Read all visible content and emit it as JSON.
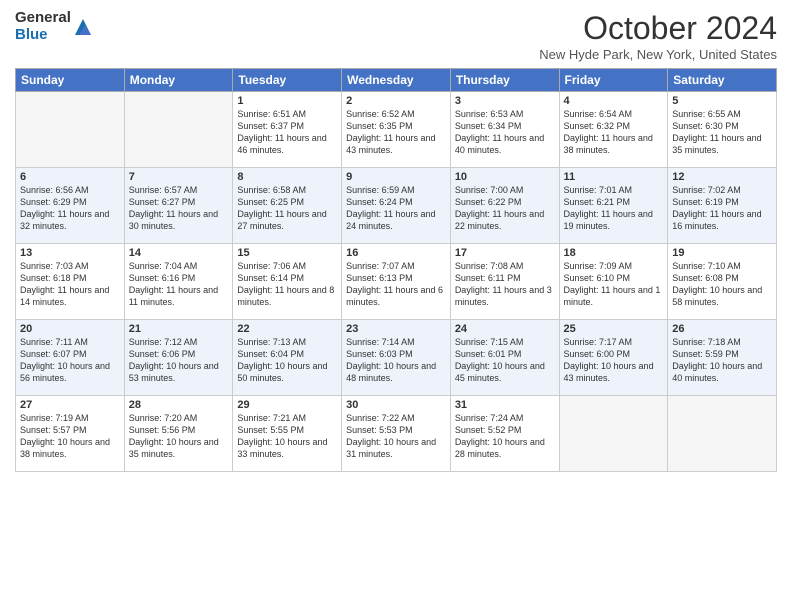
{
  "logo": {
    "general": "General",
    "blue": "Blue"
  },
  "title": "October 2024",
  "location": "New Hyde Park, New York, United States",
  "days_of_week": [
    "Sunday",
    "Monday",
    "Tuesday",
    "Wednesday",
    "Thursday",
    "Friday",
    "Saturday"
  ],
  "weeks": [
    [
      {
        "day": "",
        "info": ""
      },
      {
        "day": "",
        "info": ""
      },
      {
        "day": "1",
        "info": "Sunrise: 6:51 AM\nSunset: 6:37 PM\nDaylight: 11 hours and 46 minutes."
      },
      {
        "day": "2",
        "info": "Sunrise: 6:52 AM\nSunset: 6:35 PM\nDaylight: 11 hours and 43 minutes."
      },
      {
        "day": "3",
        "info": "Sunrise: 6:53 AM\nSunset: 6:34 PM\nDaylight: 11 hours and 40 minutes."
      },
      {
        "day": "4",
        "info": "Sunrise: 6:54 AM\nSunset: 6:32 PM\nDaylight: 11 hours and 38 minutes."
      },
      {
        "day": "5",
        "info": "Sunrise: 6:55 AM\nSunset: 6:30 PM\nDaylight: 11 hours and 35 minutes."
      }
    ],
    [
      {
        "day": "6",
        "info": "Sunrise: 6:56 AM\nSunset: 6:29 PM\nDaylight: 11 hours and 32 minutes."
      },
      {
        "day": "7",
        "info": "Sunrise: 6:57 AM\nSunset: 6:27 PM\nDaylight: 11 hours and 30 minutes."
      },
      {
        "day": "8",
        "info": "Sunrise: 6:58 AM\nSunset: 6:25 PM\nDaylight: 11 hours and 27 minutes."
      },
      {
        "day": "9",
        "info": "Sunrise: 6:59 AM\nSunset: 6:24 PM\nDaylight: 11 hours and 24 minutes."
      },
      {
        "day": "10",
        "info": "Sunrise: 7:00 AM\nSunset: 6:22 PM\nDaylight: 11 hours and 22 minutes."
      },
      {
        "day": "11",
        "info": "Sunrise: 7:01 AM\nSunset: 6:21 PM\nDaylight: 11 hours and 19 minutes."
      },
      {
        "day": "12",
        "info": "Sunrise: 7:02 AM\nSunset: 6:19 PM\nDaylight: 11 hours and 16 minutes."
      }
    ],
    [
      {
        "day": "13",
        "info": "Sunrise: 7:03 AM\nSunset: 6:18 PM\nDaylight: 11 hours and 14 minutes."
      },
      {
        "day": "14",
        "info": "Sunrise: 7:04 AM\nSunset: 6:16 PM\nDaylight: 11 hours and 11 minutes."
      },
      {
        "day": "15",
        "info": "Sunrise: 7:06 AM\nSunset: 6:14 PM\nDaylight: 11 hours and 8 minutes."
      },
      {
        "day": "16",
        "info": "Sunrise: 7:07 AM\nSunset: 6:13 PM\nDaylight: 11 hours and 6 minutes."
      },
      {
        "day": "17",
        "info": "Sunrise: 7:08 AM\nSunset: 6:11 PM\nDaylight: 11 hours and 3 minutes."
      },
      {
        "day": "18",
        "info": "Sunrise: 7:09 AM\nSunset: 6:10 PM\nDaylight: 11 hours and 1 minute."
      },
      {
        "day": "19",
        "info": "Sunrise: 7:10 AM\nSunset: 6:08 PM\nDaylight: 10 hours and 58 minutes."
      }
    ],
    [
      {
        "day": "20",
        "info": "Sunrise: 7:11 AM\nSunset: 6:07 PM\nDaylight: 10 hours and 56 minutes."
      },
      {
        "day": "21",
        "info": "Sunrise: 7:12 AM\nSunset: 6:06 PM\nDaylight: 10 hours and 53 minutes."
      },
      {
        "day": "22",
        "info": "Sunrise: 7:13 AM\nSunset: 6:04 PM\nDaylight: 10 hours and 50 minutes."
      },
      {
        "day": "23",
        "info": "Sunrise: 7:14 AM\nSunset: 6:03 PM\nDaylight: 10 hours and 48 minutes."
      },
      {
        "day": "24",
        "info": "Sunrise: 7:15 AM\nSunset: 6:01 PM\nDaylight: 10 hours and 45 minutes."
      },
      {
        "day": "25",
        "info": "Sunrise: 7:17 AM\nSunset: 6:00 PM\nDaylight: 10 hours and 43 minutes."
      },
      {
        "day": "26",
        "info": "Sunrise: 7:18 AM\nSunset: 5:59 PM\nDaylight: 10 hours and 40 minutes."
      }
    ],
    [
      {
        "day": "27",
        "info": "Sunrise: 7:19 AM\nSunset: 5:57 PM\nDaylight: 10 hours and 38 minutes."
      },
      {
        "day": "28",
        "info": "Sunrise: 7:20 AM\nSunset: 5:56 PM\nDaylight: 10 hours and 35 minutes."
      },
      {
        "day": "29",
        "info": "Sunrise: 7:21 AM\nSunset: 5:55 PM\nDaylight: 10 hours and 33 minutes."
      },
      {
        "day": "30",
        "info": "Sunrise: 7:22 AM\nSunset: 5:53 PM\nDaylight: 10 hours and 31 minutes."
      },
      {
        "day": "31",
        "info": "Sunrise: 7:24 AM\nSunset: 5:52 PM\nDaylight: 10 hours and 28 minutes."
      },
      {
        "day": "",
        "info": ""
      },
      {
        "day": "",
        "info": ""
      }
    ]
  ]
}
